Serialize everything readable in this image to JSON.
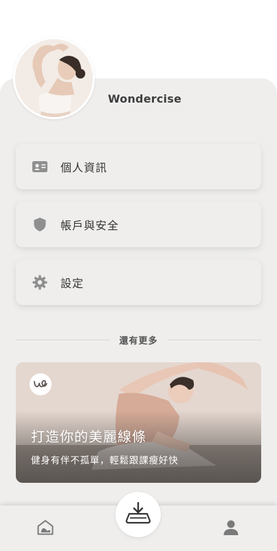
{
  "profile": {
    "username": "Wondercise"
  },
  "menu": {
    "items": [
      {
        "label": "個人資訊",
        "icon": "id-card-icon"
      },
      {
        "label": "帳戶與安全",
        "icon": "shield-icon"
      },
      {
        "label": "設定",
        "icon": "gear-icon"
      }
    ]
  },
  "more": {
    "label": "還有更多"
  },
  "promo": {
    "title": "打造你的美麗線條",
    "subtitle": "健身有伴不孤單，輕鬆跟課瘦好快",
    "logo_icon": "wondercise-logo-icon"
  },
  "nav": {
    "home_icon": "home-icon",
    "center_icon": "download-tray-icon",
    "profile_icon": "user-icon"
  },
  "colors": {
    "panel": "#efeeed",
    "icon_gray": "#8f8f8f",
    "text_dark": "#333333"
  }
}
